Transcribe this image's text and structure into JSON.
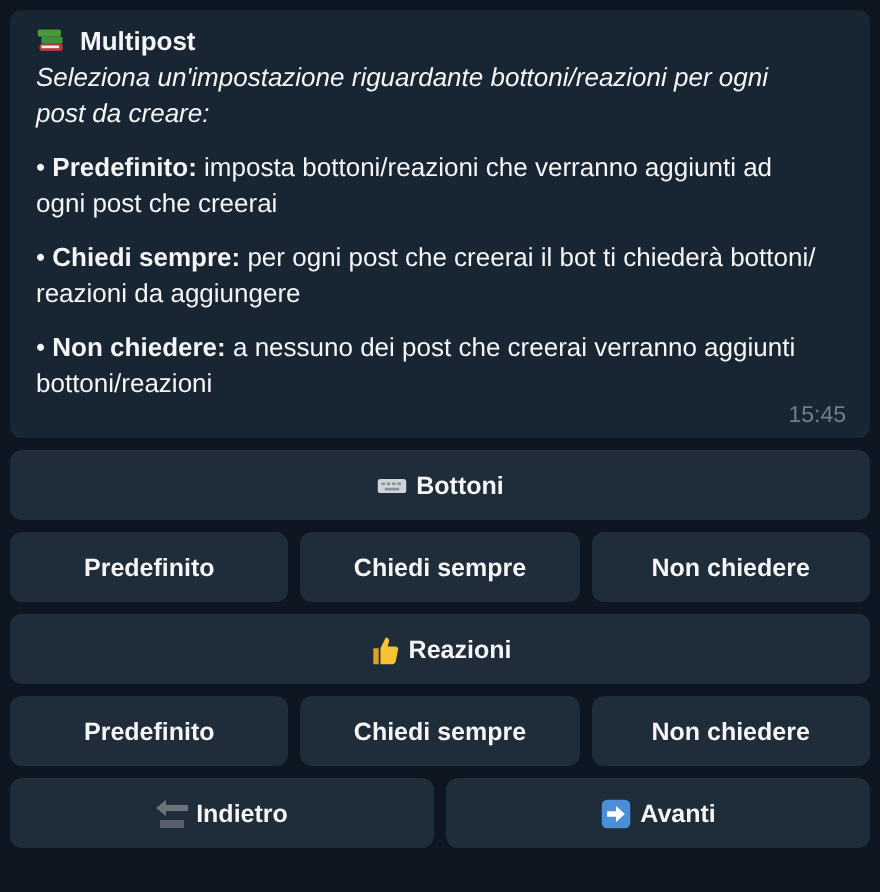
{
  "message": {
    "title": "Multipost",
    "intro": "Seleziona un'impostazione riguardante bottoni/reazioni per ogni post da creare:",
    "bullets": [
      "• **Predefinito:** imposta bottoni/reazioni che verranno aggiunti ad ogni post che creerai",
      "• **Chiedi sempre:** per ogni post che creerai il bot ti chiederà bottoni/ reazioni da aggiungere",
      "• **Non chiedere:** a nessuno dei post che creerai verranno aggiunti bottoni/reazioni"
    ],
    "time": "15:45"
  },
  "keyboard": [
    [
      {
        "label": "Bottoni",
        "kind": "keyboard"
      }
    ],
    [
      {
        "label": "Predefinito"
      },
      {
        "label": "Chiedi sempre"
      },
      {
        "label": "Non chiedere"
      }
    ],
    [
      {
        "label": "Reazioni",
        "kind": "thumbs-up"
      }
    ],
    [
      {
        "label": "Predefinito"
      },
      {
        "label": "Chiedi sempre"
      },
      {
        "label": "Non chiedere"
      }
    ],
    [
      {
        "label": "Indietro",
        "kind": "back"
      },
      {
        "label": "Avanti",
        "kind": "forward"
      }
    ]
  ]
}
